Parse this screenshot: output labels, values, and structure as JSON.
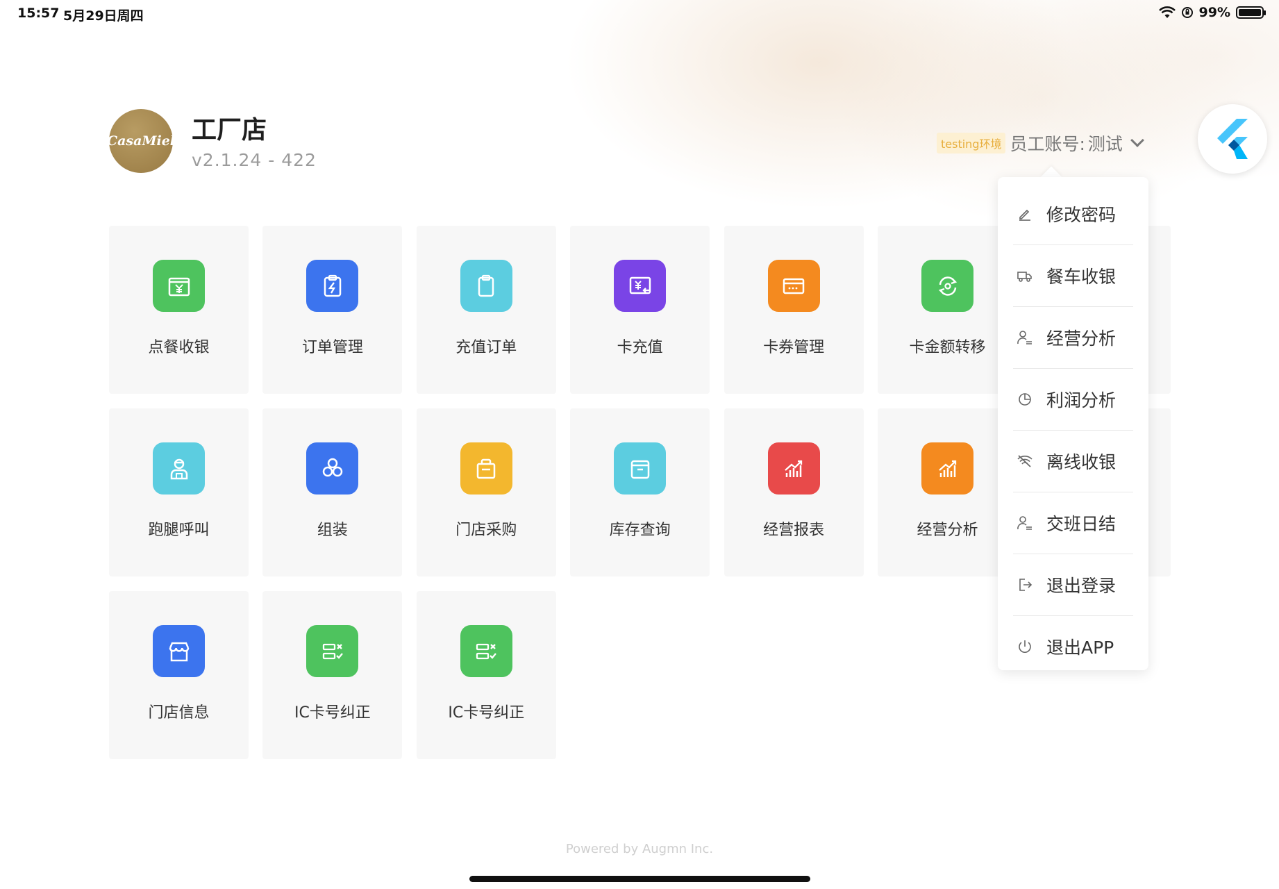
{
  "status_bar": {
    "time": "15:57",
    "date": "5月29日周四",
    "battery": "99%",
    "battery_level": 0.99
  },
  "header": {
    "logo_text": "CasaMiel",
    "store_name": "工厂店",
    "version": "v2.1.24 - 422",
    "env_badge": "testing环境",
    "account_label": "员工账号:",
    "account_value": "测试"
  },
  "colors": {
    "green": "#4ec35e",
    "blue": "#3c74ee",
    "cyan": "#5ccde0",
    "purple": "#7a44e6",
    "orange": "#f48a1f",
    "yellow": "#f3b72e",
    "red": "#e84a4a"
  },
  "tiles": [
    {
      "label": "点餐收银",
      "icon": "cash-register-icon",
      "color": "#4ec35e"
    },
    {
      "label": "订单管理",
      "icon": "order-clipboard-icon",
      "color": "#3c74ee"
    },
    {
      "label": "充值订单",
      "icon": "recharge-clipboard-icon",
      "color": "#5ccde0"
    },
    {
      "label": "卡充值",
      "icon": "card-recharge-icon",
      "color": "#7a44e6"
    },
    {
      "label": "卡券管理",
      "icon": "coupon-card-icon",
      "color": "#f48a1f"
    },
    {
      "label": "卡金额转移",
      "icon": "transfer-icon",
      "color": "#4ec35e"
    },
    {
      "label": "跑腿呼叫",
      "icon": "courier-icon",
      "color": "#5ccde0"
    },
    {
      "label": "组装",
      "icon": "assembly-hexagons-icon",
      "color": "#3c74ee"
    },
    {
      "label": "门店采购",
      "icon": "shopping-bag-icon",
      "color": "#f3b72e"
    },
    {
      "label": "库存查询",
      "icon": "inventory-box-icon",
      "color": "#5ccde0"
    },
    {
      "label": "经营报表",
      "icon": "report-chart-icon",
      "color": "#e84a4a"
    },
    {
      "label": "经营分析",
      "icon": "analysis-chart-icon",
      "color": "#f48a1f"
    },
    {
      "label": "门店信息",
      "icon": "store-icon",
      "color": "#3c74ee"
    },
    {
      "label": "IC卡号纠正",
      "icon": "ic-card-correct-icon",
      "color": "#4ec35e"
    },
    {
      "label": "IC卡号纠正",
      "icon": "ic-card-correct-icon",
      "color": "#4ec35e"
    }
  ],
  "menu": [
    {
      "label": "修改密码",
      "icon": "pencil-icon"
    },
    {
      "label": "餐车收银",
      "icon": "truck-icon"
    },
    {
      "label": "经营分析",
      "icon": "user-analysis-icon"
    },
    {
      "label": "利润分析",
      "icon": "pie-chart-icon"
    },
    {
      "label": "离线收银",
      "icon": "wifi-off-icon"
    },
    {
      "label": "交班日结",
      "icon": "user-shift-icon"
    },
    {
      "label": "退出登录",
      "icon": "logout-icon"
    },
    {
      "label": "退出APP",
      "icon": "power-icon"
    }
  ],
  "footer": "Powered by Augmn Inc."
}
